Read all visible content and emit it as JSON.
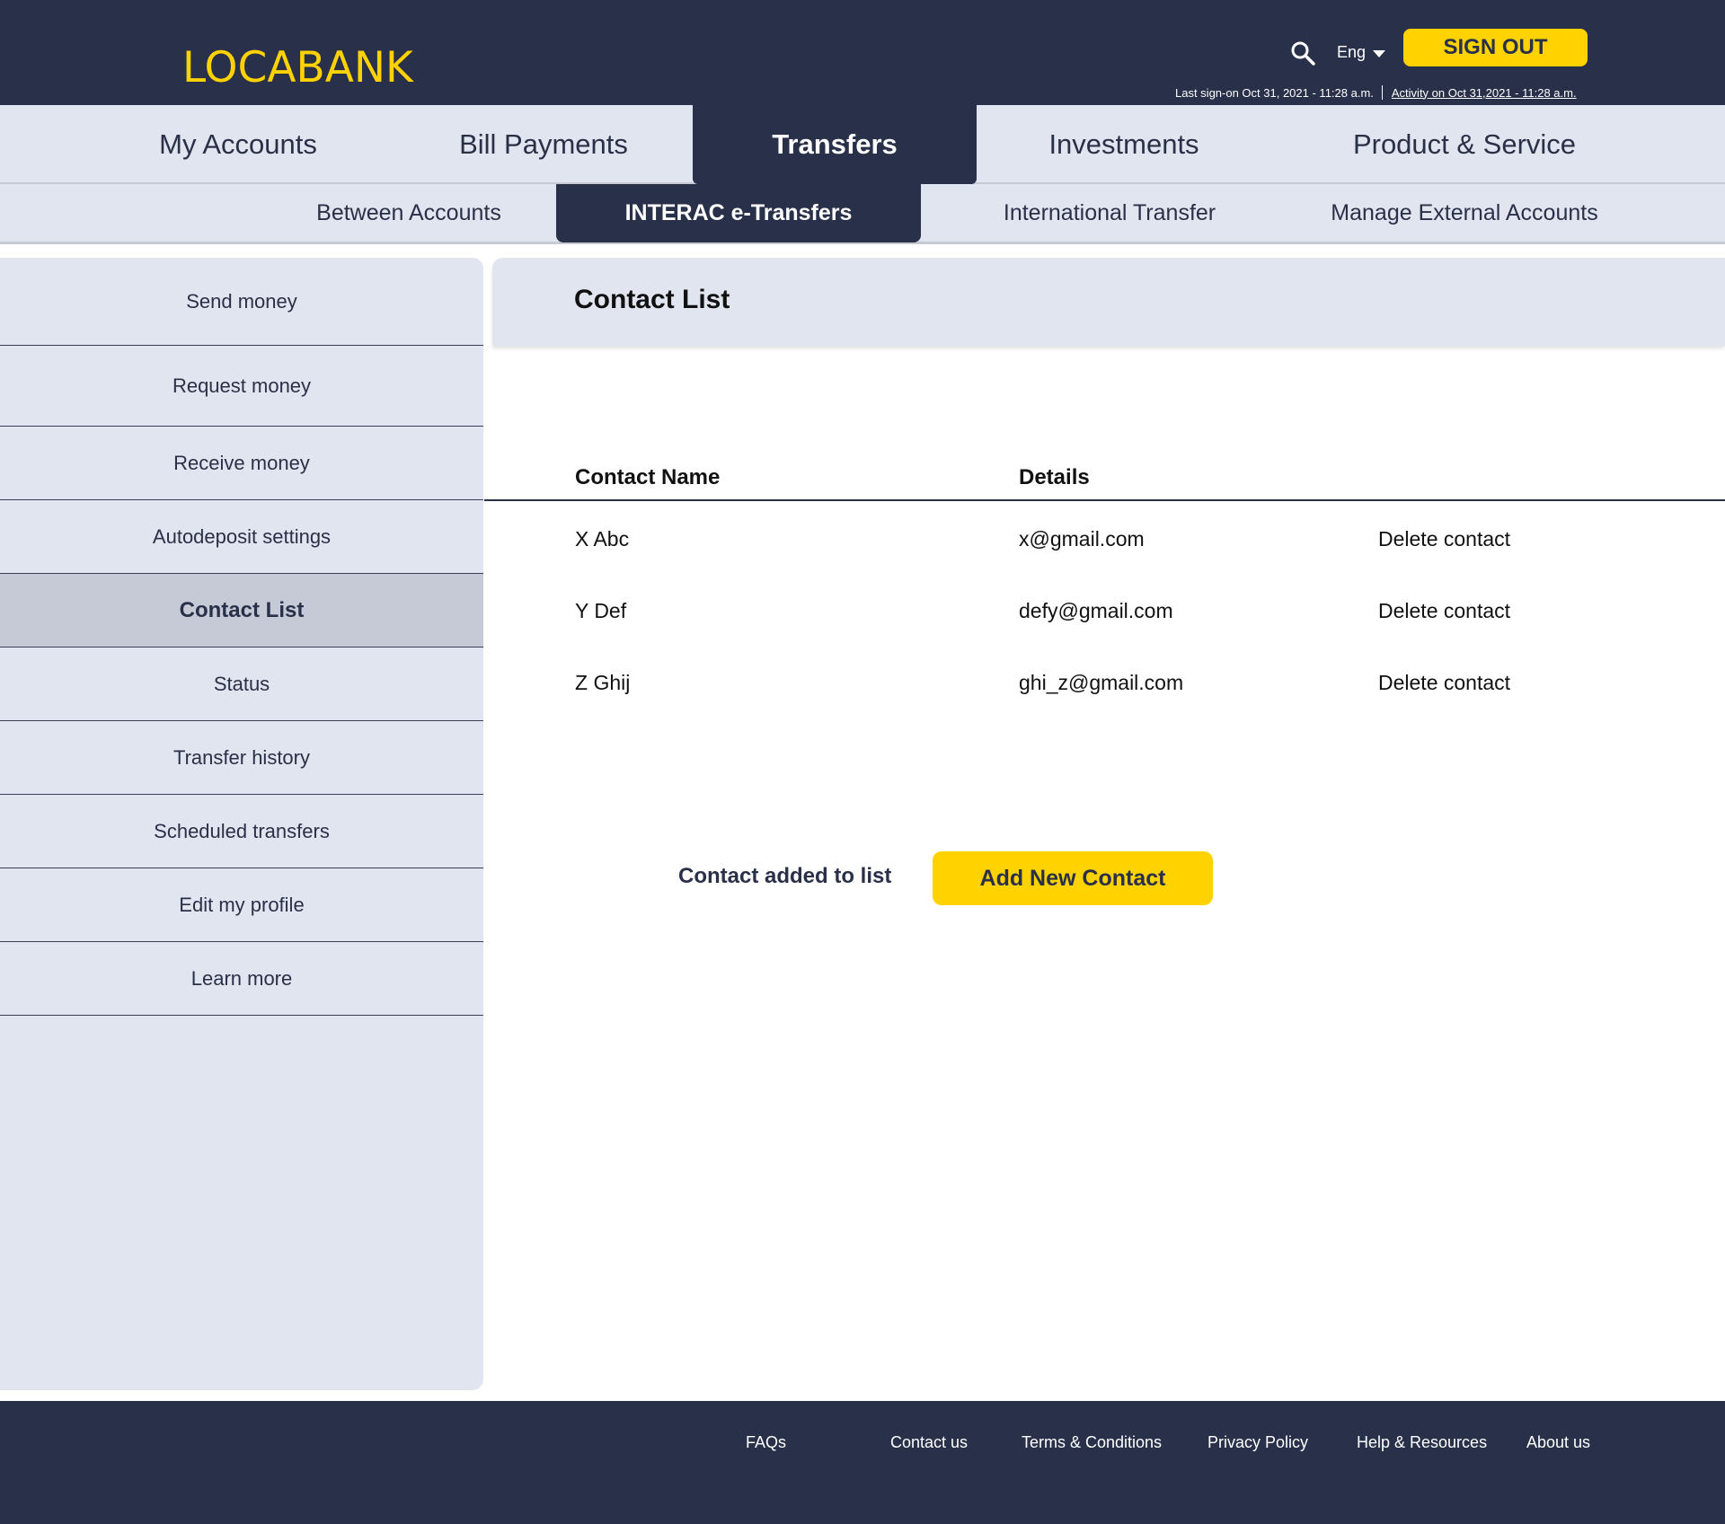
{
  "header": {
    "logo": "LOCABANK",
    "language": "Eng",
    "sign_out_label": "SIGN OUT",
    "last_sign_on": "Last sign-on Oct 31, 2021 - 11:28 a.m.",
    "activity_link": " Activity on Oct 31,2021 - 11:28 a.m."
  },
  "main_nav": {
    "tabs": [
      {
        "label": "My Accounts"
      },
      {
        "label": "Bill Payments"
      },
      {
        "label": "Transfers",
        "active": true
      },
      {
        "label": "Investments"
      },
      {
        "label": "Product & Service"
      }
    ]
  },
  "sub_nav": {
    "tabs": [
      {
        "label": "Between Accounts"
      },
      {
        "label": "INTERAC e-Transfers",
        "active": true
      },
      {
        "label": "International Transfer"
      },
      {
        "label": "Manage External Accounts"
      }
    ]
  },
  "sidebar": {
    "items": [
      {
        "label": "Send money"
      },
      {
        "label": "Request money"
      },
      {
        "label": "Receive money"
      },
      {
        "label": "Autodeposit settings"
      },
      {
        "label": "Contact List",
        "active": true
      },
      {
        "label": "Status"
      },
      {
        "label": "Transfer history"
      },
      {
        "label": "Scheduled transfers"
      },
      {
        "label": "Edit my profile"
      },
      {
        "label": "Learn more"
      }
    ]
  },
  "content": {
    "title": "Contact List",
    "table": {
      "columns": [
        "Contact Name",
        "Details"
      ],
      "rows": [
        {
          "name": "X Abc",
          "details": "x@gmail.com",
          "action": "Delete contact"
        },
        {
          "name": "Y Def",
          "details": "defy@gmail.com",
          "action": "Delete contact"
        },
        {
          "name": "Z Ghij",
          "details": "ghi_z@gmail.com",
          "action": "Delete contact"
        }
      ]
    },
    "status_message": "Contact added to list",
    "add_button_label": "Add New Contact"
  },
  "footer": {
    "links": [
      "FAQs",
      "Contact us",
      "Terms & Conditions",
      "Privacy Policy",
      "Help & Resources",
      "About us"
    ]
  },
  "colors": {
    "navy": "#293049",
    "accent_yellow": "#ffd200",
    "panel_bg": "#e1e5ef",
    "active_side_bg": "#c6cad7"
  }
}
